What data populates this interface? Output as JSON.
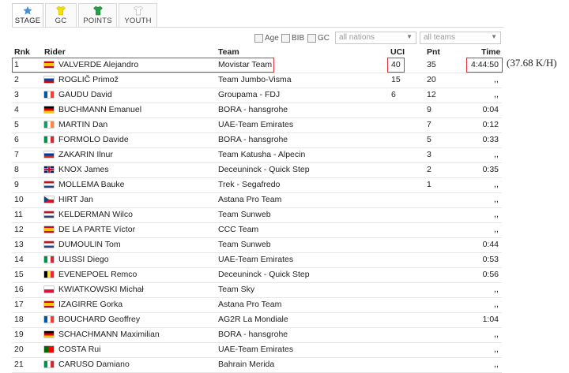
{
  "tabs": [
    {
      "label": "STAGE",
      "icon": "star-icon",
      "color": "#4a90d9",
      "active": true
    },
    {
      "label": "GC",
      "icon": "jersey-icon",
      "color": "#f4e100"
    },
    {
      "label": "POINTS",
      "icon": "jersey-icon",
      "color": "#25a244"
    },
    {
      "label": "YOUTH",
      "icon": "jersey-icon",
      "color": "#ffffff"
    }
  ],
  "filters": {
    "age": "Age",
    "bib": "BIB",
    "gc": "GC",
    "nations": "all nations",
    "teams": "all teams"
  },
  "columns": {
    "rnk": "Rnk",
    "rider": "Rider",
    "team": "Team",
    "uci": "UCI",
    "pnt": "Pnt",
    "time": "Time"
  },
  "rows": [
    {
      "rnk": "1",
      "flag": "es",
      "rider": "VALVERDE Alejandro",
      "team": "Movistar Team",
      "uci": "40",
      "pnt": "35",
      "time": "4:44:50"
    },
    {
      "rnk": "2",
      "flag": "si",
      "rider": "ROGLIČ Primož",
      "team": "Team Jumbo-Visma",
      "uci": "15",
      "pnt": "20",
      "time": ",,"
    },
    {
      "rnk": "3",
      "flag": "fr",
      "rider": "GAUDU David",
      "team": "Groupama - FDJ",
      "uci": "6",
      "pnt": "12",
      "time": ",,"
    },
    {
      "rnk": "4",
      "flag": "de",
      "rider": "BUCHMANN Emanuel",
      "team": "BORA - hansgrohe",
      "uci": "",
      "pnt": "9",
      "time": "0:04"
    },
    {
      "rnk": "5",
      "flag": "ie",
      "rider": "MARTIN Dan",
      "team": "UAE-Team Emirates",
      "uci": "",
      "pnt": "7",
      "time": "0:12"
    },
    {
      "rnk": "6",
      "flag": "it",
      "rider": "FORMOLO Davide",
      "team": "BORA - hansgrohe",
      "uci": "",
      "pnt": "5",
      "time": "0:33"
    },
    {
      "rnk": "7",
      "flag": "ru",
      "rider": "ZAKARIN Ilnur",
      "team": "Team Katusha - Alpecin",
      "uci": "",
      "pnt": "3",
      "time": ",,"
    },
    {
      "rnk": "8",
      "flag": "gb",
      "rider": "KNOX James",
      "team": "Deceuninck - Quick Step",
      "uci": "",
      "pnt": "2",
      "time": "0:35"
    },
    {
      "rnk": "9",
      "flag": "nl",
      "rider": "MOLLEMA Bauke",
      "team": "Trek - Segafredo",
      "uci": "",
      "pnt": "1",
      "time": ",,"
    },
    {
      "rnk": "10",
      "flag": "cz",
      "rider": "HIRT Jan",
      "team": "Astana Pro Team",
      "uci": "",
      "pnt": "",
      "time": ",,"
    },
    {
      "rnk": "11",
      "flag": "nl",
      "rider": "KELDERMAN Wilco",
      "team": "Team Sunweb",
      "uci": "",
      "pnt": "",
      "time": ",,"
    },
    {
      "rnk": "12",
      "flag": "es",
      "rider": "DE LA PARTE Víctor",
      "team": "CCC Team",
      "uci": "",
      "pnt": "",
      "time": ",,"
    },
    {
      "rnk": "13",
      "flag": "nl",
      "rider": "DUMOULIN Tom",
      "team": "Team Sunweb",
      "uci": "",
      "pnt": "",
      "time": "0:44"
    },
    {
      "rnk": "14",
      "flag": "it",
      "rider": "ULISSI Diego",
      "team": "UAE-Team Emirates",
      "uci": "",
      "pnt": "",
      "time": "0:53"
    },
    {
      "rnk": "15",
      "flag": "be",
      "rider": "EVENEPOEL Remco",
      "team": "Deceuninck - Quick Step",
      "uci": "",
      "pnt": "",
      "time": "0:56"
    },
    {
      "rnk": "16",
      "flag": "pl",
      "rider": "KWIATKOWSKI Michał",
      "team": "Team Sky",
      "uci": "",
      "pnt": "",
      "time": ",,"
    },
    {
      "rnk": "17",
      "flag": "es",
      "rider": "IZAGIRRE Gorka",
      "team": "Astana Pro Team",
      "uci": "",
      "pnt": "",
      "time": ",,"
    },
    {
      "rnk": "18",
      "flag": "fr",
      "rider": "BOUCHARD Geoffrey",
      "team": "AG2R La Mondiale",
      "uci": "",
      "pnt": "",
      "time": "1:04"
    },
    {
      "rnk": "19",
      "flag": "de",
      "rider": "SCHACHMANN Maximilian",
      "team": "BORA - hansgrohe",
      "uci": "",
      "pnt": "",
      "time": ",,"
    },
    {
      "rnk": "20",
      "flag": "pt",
      "rider": "COSTA Rui",
      "team": "UAE-Team Emirates",
      "uci": "",
      "pnt": "",
      "time": ",,"
    },
    {
      "rnk": "21",
      "flag": "it",
      "rider": "CARUSO Damiano",
      "team": "Bahrain Merida",
      "uci": "",
      "pnt": "",
      "time": ",,"
    }
  ],
  "annotation": {
    "speed": "(37.68 K/H)",
    "highlight_color": "#e0303a"
  }
}
